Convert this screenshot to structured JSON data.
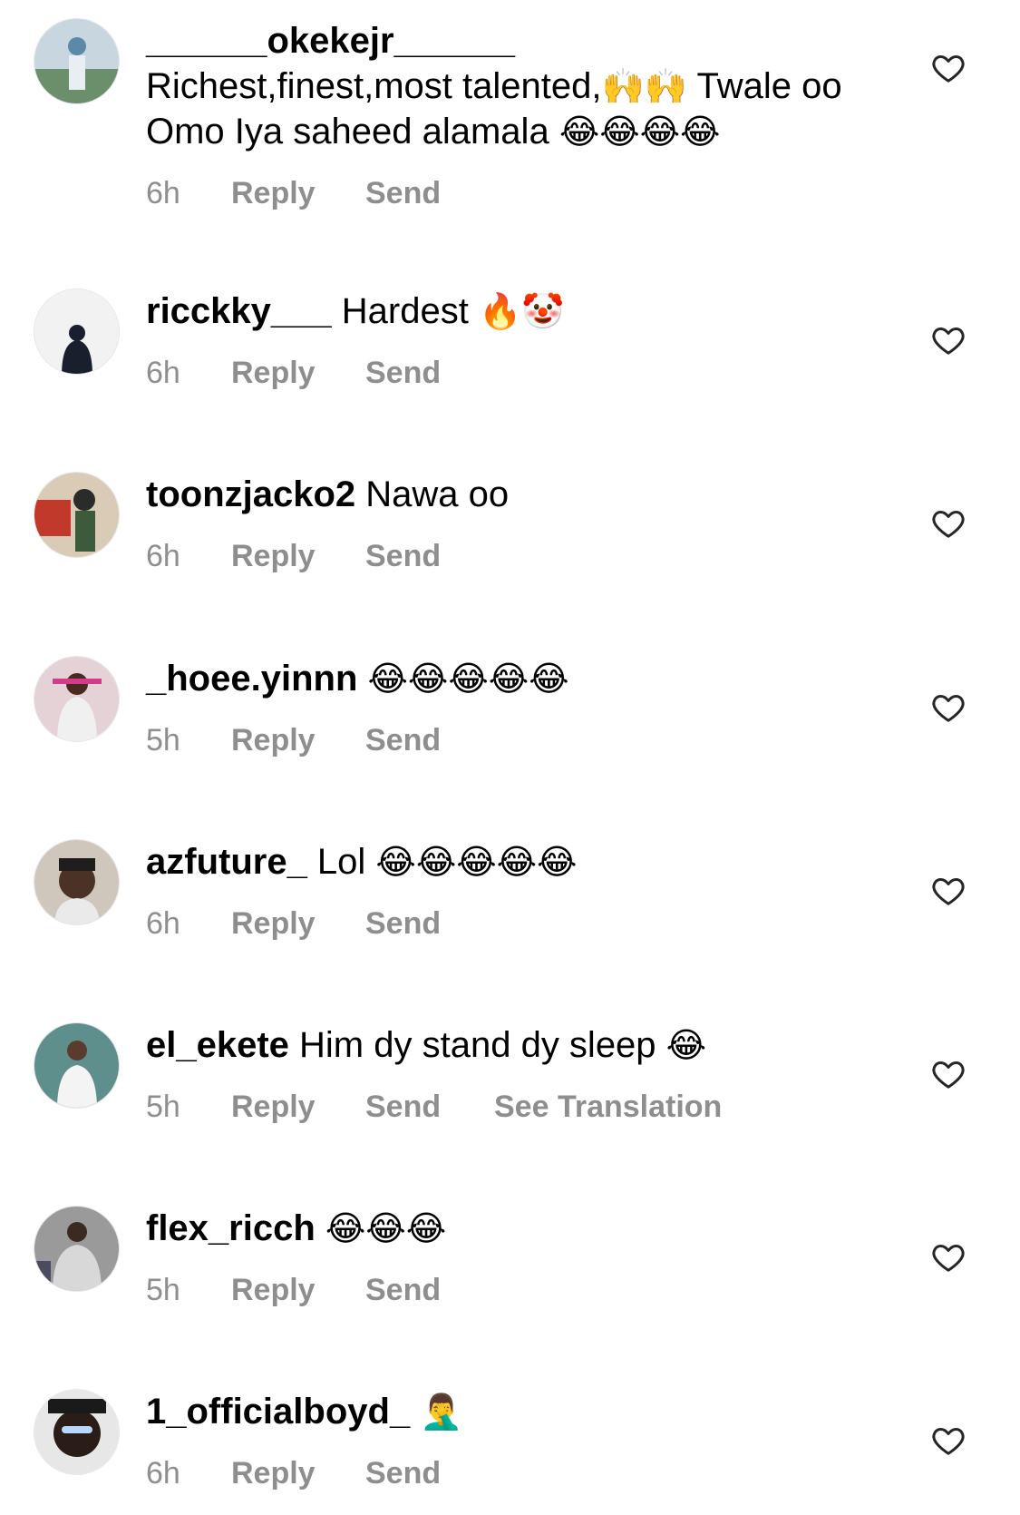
{
  "colors": {
    "meta_text": "#8e8e8e",
    "heart_stroke": "#262626"
  },
  "comments": [
    {
      "username": "______okekejr______",
      "text": "Richest,finest,most talented,",
      "emoji_1": "🙌🙌",
      "text_2": " Twale oo Omo Iya saheed alamala ",
      "emoji_2": "😂😂😂😂",
      "time": "6h",
      "reply": "Reply",
      "send": "Send",
      "avatar_color": "#5b8aa8",
      "like_icon": "heart-outline-icon"
    },
    {
      "username": "ricckky___",
      "text": " Hardest ",
      "emoji_1": "🔥🤡",
      "time": "6h",
      "reply": "Reply",
      "send": "Send",
      "avatar_color": "#e9e9ea",
      "like_icon": "heart-outline-icon"
    },
    {
      "username": "toonzjacko2",
      "text": " Nawa oo",
      "time": "6h",
      "reply": "Reply",
      "send": "Send",
      "avatar_color": "#8c6b4a",
      "like_icon": "heart-outline-icon"
    },
    {
      "username": "_hoee.yinnn",
      "text": " ",
      "emoji_1": "😂😂😂😂😂",
      "time": "5h",
      "reply": "Reply",
      "send": "Send",
      "avatar_color": "#b24a5a",
      "like_icon": "heart-outline-icon"
    },
    {
      "username": "azfuture_",
      "text": " Lol ",
      "emoji_1": "😂😂😂😂😂",
      "time": "6h",
      "reply": "Reply",
      "send": "Send",
      "avatar_color": "#6b5a4a",
      "like_icon": "heart-outline-icon"
    },
    {
      "username": "el_ekete",
      "text": " Him dy stand dy sleep ",
      "emoji_1": "😂",
      "time": "5h",
      "reply": "Reply",
      "send": "Send",
      "translate": "See Translation",
      "avatar_color": "#4a7f7f",
      "like_icon": "heart-outline-icon"
    },
    {
      "username": "flex_ricch",
      "text": " ",
      "emoji_1": "😂😂😂",
      "time": "5h",
      "reply": "Reply",
      "send": "Send",
      "avatar_color": "#7a7a7a",
      "like_icon": "heart-outline-icon"
    },
    {
      "username": "1_officialboyd_",
      "text": " ",
      "emoji_1": "🤦‍♂️",
      "time": "6h",
      "reply": "Reply",
      "send": "Send",
      "avatar_color": "#3a3a3a",
      "like_icon": "heart-outline-icon"
    }
  ]
}
